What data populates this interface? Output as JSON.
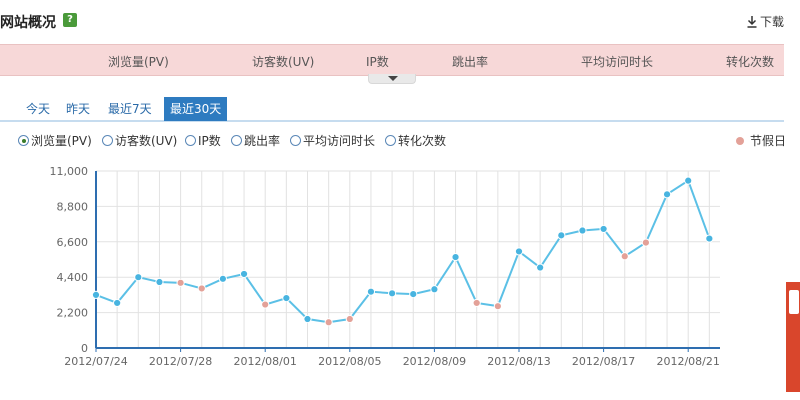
{
  "header": {
    "title": "网站概况",
    "help_icon": "?",
    "download_label": "下载"
  },
  "metrics": [
    "浏览量(PV)",
    "访客数(UV)",
    "IP数",
    "跳出率",
    "平均访问时长",
    "转化次数"
  ],
  "time_tabs": [
    {
      "label": "今天",
      "active": false
    },
    {
      "label": "昨天",
      "active": false
    },
    {
      "label": "最近7天",
      "active": false
    },
    {
      "label": "最近30天",
      "active": true
    }
  ],
  "radio_options": [
    {
      "label": "浏览量(PV)",
      "checked": true
    },
    {
      "label": "访客数(UV)",
      "checked": false
    },
    {
      "label": "IP数",
      "checked": false
    },
    {
      "label": "跳出率",
      "checked": false
    },
    {
      "label": "平均访问时长",
      "checked": false
    },
    {
      "label": "转化次数",
      "checked": false
    }
  ],
  "holiday_legend": "节假日",
  "colors": {
    "line": "#5bc0e6",
    "point": "#48b4e0",
    "holiday_point": "#e3a198",
    "axis": "#2e6eb0",
    "grid": "#e2e2e2",
    "metrics_bg": "#f7d8d8",
    "tab_active": "#2e7bc0"
  },
  "chart_data": {
    "type": "line",
    "x": [
      "2012/07/24",
      "2012/07/25",
      "2012/07/26",
      "2012/07/27",
      "2012/07/28",
      "2012/07/29",
      "2012/07/30",
      "2012/07/31",
      "2012/08/01",
      "2012/08/02",
      "2012/08/03",
      "2012/08/04",
      "2012/08/05",
      "2012/08/06",
      "2012/08/07",
      "2012/08/08",
      "2012/08/09",
      "2012/08/10",
      "2012/08/11",
      "2012/08/12",
      "2012/08/13",
      "2012/08/14",
      "2012/08/15",
      "2012/08/16",
      "2012/08/17",
      "2012/08/18",
      "2012/08/19",
      "2012/08/20",
      "2012/08/21",
      "2012/08/22"
    ],
    "values": [
      3300,
      2800,
      4400,
      4100,
      4050,
      3700,
      4300,
      4600,
      2700,
      3100,
      1800,
      1600,
      1800,
      3500,
      3400,
      3350,
      3650,
      5650,
      2800,
      2600,
      6000,
      5000,
      7000,
      7300,
      7400,
      5700,
      6550,
      9550,
      10400,
      6800
    ],
    "holiday": [
      false,
      false,
      false,
      false,
      true,
      true,
      false,
      false,
      true,
      false,
      false,
      true,
      true,
      false,
      false,
      false,
      false,
      false,
      true,
      true,
      false,
      false,
      false,
      false,
      false,
      true,
      true,
      false,
      false,
      false
    ],
    "x_tick_labels": [
      "2012/07/24",
      "2012/07/28",
      "2012/08/01",
      "2012/08/05",
      "2012/08/09",
      "2012/08/13",
      "2012/08/17",
      "2012/08/21"
    ],
    "y_tick_labels": [
      "0",
      "2,200",
      "4,400",
      "6,600",
      "8,800",
      "11,000"
    ],
    "ylim": [
      0,
      11000
    ],
    "grid": true,
    "legend": "top-right"
  }
}
